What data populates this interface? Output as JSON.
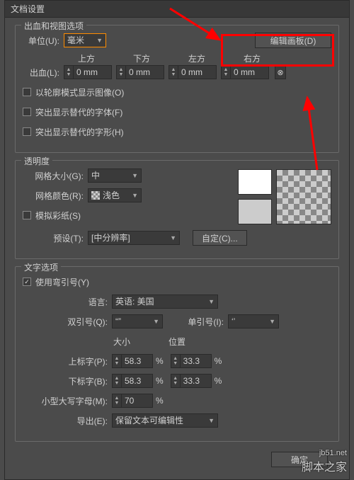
{
  "title": "文档设置",
  "group1": {
    "title": "出血和视图选项",
    "unit_label": "单位(U):",
    "unit_value": "毫米",
    "edit_artboard": "编辑画板(D)",
    "top": "上方",
    "bottom": "下方",
    "left": "左方",
    "right": "右方",
    "bleed_label": "出血(L):",
    "bleed_val": "0 mm",
    "cb1": "以轮廓模式显示图像(O)",
    "cb2": "突出显示替代的字体(F)",
    "cb3": "突出显示替代的字形(H)"
  },
  "group2": {
    "title": "透明度",
    "grid_size_label": "网格大小(G):",
    "grid_size_value": "中",
    "grid_color_label": "网格颜色(R):",
    "grid_color_value": "浅色",
    "simulate_paper": "模拟彩纸(S)",
    "preset_label": "预设(T):",
    "preset_value": "[中分辨率]",
    "custom_btn": "自定(C)..."
  },
  "group3": {
    "title": "文字选项",
    "use_quotes": "使用弯引号(Y)",
    "lang_label": "语言:",
    "lang_value": "英语: 美国",
    "dquote_label": "双引号(Q):",
    "dquote_value": "“”",
    "squote_label": "单引号(I):",
    "squote_value": "‘’",
    "size_hdr": "大小",
    "pos_hdr": "位置",
    "sup_label": "上标字(P):",
    "sub_label": "下标字(B):",
    "val_583": "58.3",
    "val_333": "33.3",
    "pct": "%",
    "smallcap_label": "小型大写字母(M):",
    "smallcap_val": "70",
    "export_label": "导出(E):",
    "export_value": "保留文本可编辑性"
  },
  "ok": "确定",
  "watermark": "脚本之家",
  "watermark_url": "jb51.net"
}
